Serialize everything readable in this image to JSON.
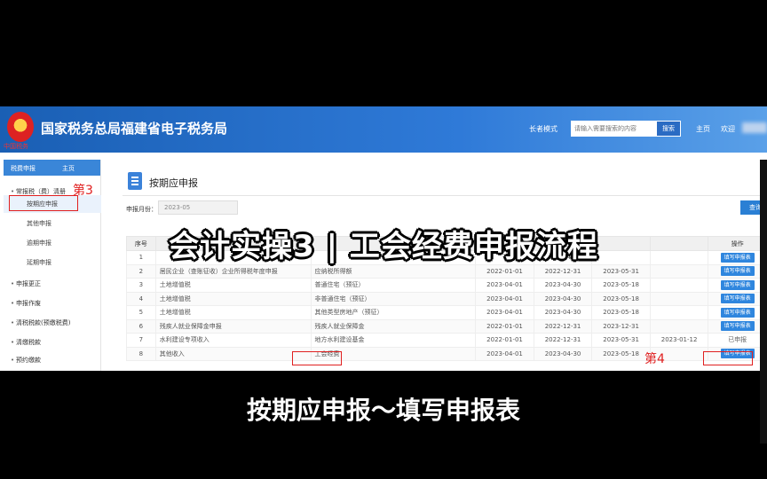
{
  "header": {
    "site_title": "国家税务总局福建省电子税务局",
    "emblem_text": "中国税务",
    "elder_mode": "长者模式",
    "search_placeholder": "请输入需要搜索的内容",
    "search_button": "搜索",
    "home": "主页",
    "welcome": "欢迎"
  },
  "sidebar": {
    "title": "税费申报",
    "home": "主页",
    "items": [
      {
        "label": "常报税（费）清册",
        "type": "group"
      },
      {
        "label": "按期应申报",
        "type": "sub"
      },
      {
        "label": "其他申报",
        "type": "sub"
      },
      {
        "label": "逾期申报",
        "type": "sub"
      },
      {
        "label": "延期申报",
        "type": "sub"
      },
      {
        "label": "申报更正",
        "type": "group"
      },
      {
        "label": "申报作废",
        "type": "group"
      },
      {
        "label": "清税税款(预缴税费)",
        "type": "group"
      },
      {
        "label": "清缴税款",
        "type": "group"
      },
      {
        "label": "预约缴款",
        "type": "group"
      }
    ]
  },
  "annotations": {
    "step3": "第3",
    "step4": "第4"
  },
  "main": {
    "page_title": "按期应申报",
    "period_label": "申报月份：",
    "period_value": "2023-05",
    "query_button": "查询",
    "r_chip": "R",
    "columns": [
      "序号",
      "",
      "征收品目",
      "",
      "",
      "",
      "",
      "操作"
    ],
    "rows": [
      {
        "no": "1",
        "tax": "",
        "item": "",
        "start": "",
        "end": "2023-04-30",
        "deadline": "",
        "date": "",
        "op": "btn"
      },
      {
        "no": "2",
        "tax": "居民企业（查账征收）企业所得税年度申报",
        "item": "应纳税所得额",
        "start": "2022-01-01",
        "end": "2022-12-31",
        "deadline": "2023-05-31",
        "date": "",
        "op": "btn"
      },
      {
        "no": "3",
        "tax": "土地增值税",
        "item": "普通住宅（预征）",
        "start": "2023-04-01",
        "end": "2023-04-30",
        "deadline": "2023-05-18",
        "date": "",
        "op": "btn"
      },
      {
        "no": "4",
        "tax": "土地增值税",
        "item": "非普通住宅（预征）",
        "start": "2023-04-01",
        "end": "2023-04-30",
        "deadline": "2023-05-18",
        "date": "",
        "op": "btn"
      },
      {
        "no": "5",
        "tax": "土地增值税",
        "item": "其他类型房地产（预征）",
        "start": "2023-04-01",
        "end": "2023-04-30",
        "deadline": "2023-05-18",
        "date": "",
        "op": "btn"
      },
      {
        "no": "6",
        "tax": "残疾人就业保障金申报",
        "item": "残疾人就业保障金",
        "start": "2022-01-01",
        "end": "2022-12-31",
        "deadline": "2023-12-31",
        "date": "",
        "op": "btn"
      },
      {
        "no": "7",
        "tax": "水利建设专项收入",
        "item": "地方水利建设基金",
        "start": "2022-01-01",
        "end": "2022-12-31",
        "deadline": "2023-05-31",
        "date": "2023-01-12",
        "op": "declared"
      },
      {
        "no": "8",
        "tax": "其他收入",
        "item": "工会经费",
        "start": "2023-04-01",
        "end": "2023-04-30",
        "deadline": "2023-05-18",
        "date": "",
        "op": "btn"
      }
    ],
    "fill_button": "填写申报表",
    "declared_text": "已申报"
  },
  "overlay": {
    "title": "会计实操3 | 工会经费申报流程",
    "caption": "按期应申报～填写申报表"
  }
}
